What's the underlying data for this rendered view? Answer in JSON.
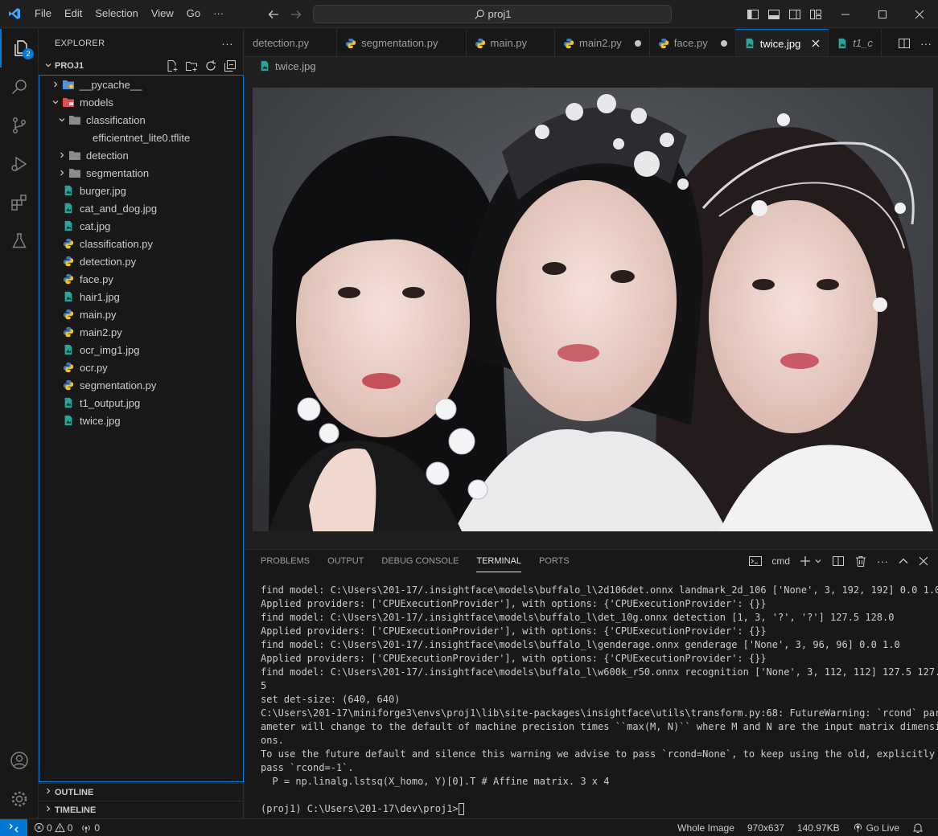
{
  "menu": [
    "File",
    "Edit",
    "Selection",
    "View",
    "Go",
    "···"
  ],
  "command_center": "proj1",
  "activity_badge": "2",
  "explorer": {
    "title": "EXPLORER",
    "more": "···",
    "project": "PROJ1",
    "tree": [
      {
        "label": "__pycache__",
        "type": "folder-py",
        "depth": 0,
        "open": false
      },
      {
        "label": "models",
        "type": "folder-models",
        "depth": 0,
        "open": true
      },
      {
        "label": "classification",
        "type": "folder",
        "depth": 1,
        "open": true
      },
      {
        "label": "efficientnet_lite0.tflite",
        "type": "file",
        "depth": 2
      },
      {
        "label": "detection",
        "type": "folder",
        "depth": 1,
        "open": false
      },
      {
        "label": "segmentation",
        "type": "folder",
        "depth": 1,
        "open": false
      },
      {
        "label": "burger.jpg",
        "type": "image",
        "depth": 0
      },
      {
        "label": "cat_and_dog.jpg",
        "type": "image",
        "depth": 0
      },
      {
        "label": "cat.jpg",
        "type": "image",
        "depth": 0
      },
      {
        "label": "classification.py",
        "type": "python",
        "depth": 0
      },
      {
        "label": "detection.py",
        "type": "python",
        "depth": 0
      },
      {
        "label": "face.py",
        "type": "python",
        "depth": 0
      },
      {
        "label": "hair1.jpg",
        "type": "image",
        "depth": 0
      },
      {
        "label": "main.py",
        "type": "python",
        "depth": 0
      },
      {
        "label": "main2.py",
        "type": "python",
        "depth": 0
      },
      {
        "label": "ocr_img1.jpg",
        "type": "image",
        "depth": 0
      },
      {
        "label": "ocr.py",
        "type": "python",
        "depth": 0
      },
      {
        "label": "segmentation.py",
        "type": "python",
        "depth": 0
      },
      {
        "label": "t1_output.jpg",
        "type": "image",
        "depth": 0
      },
      {
        "label": "twice.jpg",
        "type": "image",
        "depth": 0
      }
    ],
    "outline": "OUTLINE",
    "timeline": "TIMELINE"
  },
  "tabs": [
    {
      "label": "detection.py",
      "icon": "none",
      "dirty": false,
      "active": false,
      "italic": false
    },
    {
      "label": "segmentation.py",
      "icon": "python",
      "dirty": false,
      "active": false,
      "italic": false
    },
    {
      "label": "main.py",
      "icon": "python",
      "dirty": false,
      "active": false,
      "italic": false
    },
    {
      "label": "main2.py",
      "icon": "python",
      "dirty": true,
      "active": false,
      "italic": false
    },
    {
      "label": "face.py",
      "icon": "python",
      "dirty": true,
      "active": false,
      "italic": false
    },
    {
      "label": "twice.jpg",
      "icon": "image",
      "dirty": false,
      "active": true,
      "italic": false
    },
    {
      "label": "t1_c",
      "icon": "image",
      "dirty": false,
      "active": false,
      "italic": true
    }
  ],
  "breadcrumb": "twice.jpg",
  "panel": {
    "tabs": [
      "PROBLEMS",
      "OUTPUT",
      "DEBUG CONSOLE",
      "TERMINAL",
      "PORTS"
    ],
    "active_tab": "TERMINAL",
    "shell": "cmd",
    "lines": [
      "find model: C:\\Users\\201-17/.insightface\\models\\buffalo_l\\2d106det.onnx landmark_2d_106 ['None', 3, 192, 192] 0.0 1.0",
      "Applied providers: ['CPUExecutionProvider'], with options: {'CPUExecutionProvider': {}}",
      "find model: C:\\Users\\201-17/.insightface\\models\\buffalo_l\\det_10g.onnx detection [1, 3, '?', '?'] 127.5 128.0",
      "Applied providers: ['CPUExecutionProvider'], with options: {'CPUExecutionProvider': {}}",
      "find model: C:\\Users\\201-17/.insightface\\models\\buffalo_l\\genderage.onnx genderage ['None', 3, 96, 96] 0.0 1.0",
      "Applied providers: ['CPUExecutionProvider'], with options: {'CPUExecutionProvider': {}}",
      "find model: C:\\Users\\201-17/.insightface\\models\\buffalo_l\\w600k_r50.onnx recognition ['None', 3, 112, 112] 127.5 127.",
      "5",
      "set det-size: (640, 640)",
      "C:\\Users\\201-17\\miniforge3\\envs\\proj1\\lib\\site-packages\\insightface\\utils\\transform.py:68: FutureWarning: `rcond` par",
      "ameter will change to the default of machine precision times ``max(M, N)`` where M and N are the input matrix dimensi",
      "ons.",
      "To use the future default and silence this warning we advise to pass `rcond=None`, to keep using the old, explicitly",
      "pass `rcond=-1`.",
      "  P = np.linalg.lstsq(X_homo, Y)[0].T # Affine matrix. 3 x 4",
      ""
    ],
    "prompt": "(proj1) C:\\Users\\201-17\\dev\\proj1>"
  },
  "status": {
    "errors": "0",
    "warnings": "0",
    "ports": "0",
    "view": "Whole Image",
    "dimensions": "970x637",
    "size": "140.97KB",
    "golive": "Go Live"
  },
  "colors": {
    "accent": "#0078d4",
    "python_blue": "#3572a5",
    "python_yellow": "#ffd43b",
    "image_teal": "#26a69a"
  }
}
